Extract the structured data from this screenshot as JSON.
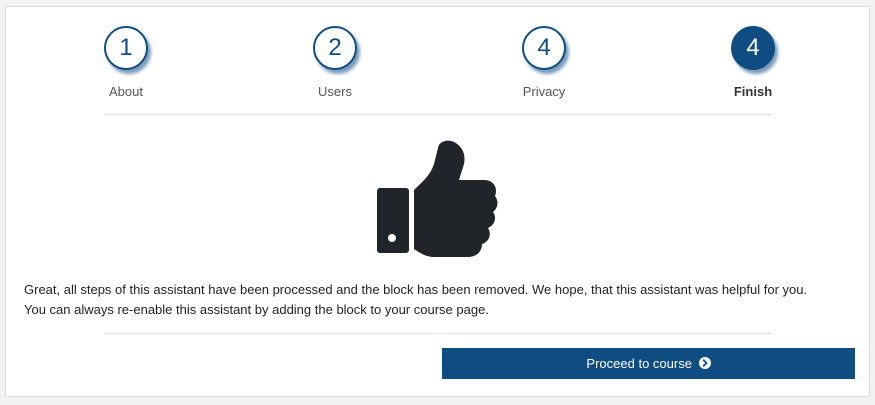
{
  "wizard": {
    "steps": [
      {
        "number": "1",
        "label": "About",
        "active": false
      },
      {
        "number": "2",
        "label": "Users",
        "active": false
      },
      {
        "number": "4",
        "label": "Privacy",
        "active": false
      },
      {
        "number": "4",
        "label": "Finish",
        "active": true
      }
    ]
  },
  "result": {
    "icon": "thumbs-up-icon",
    "line1": "Great, all steps of this assistant have been processed and the block has been removed. We hope, that this assistant was helpful for you.",
    "line2": "You can always re-enable this assistant by adding the block to your course page."
  },
  "actions": {
    "proceed_label": "Proceed to course",
    "proceed_icon": "chevron-circle-right-icon"
  },
  "colors": {
    "accent": "#0f4c81",
    "icon": "#212529",
    "background": "#ffffff"
  }
}
